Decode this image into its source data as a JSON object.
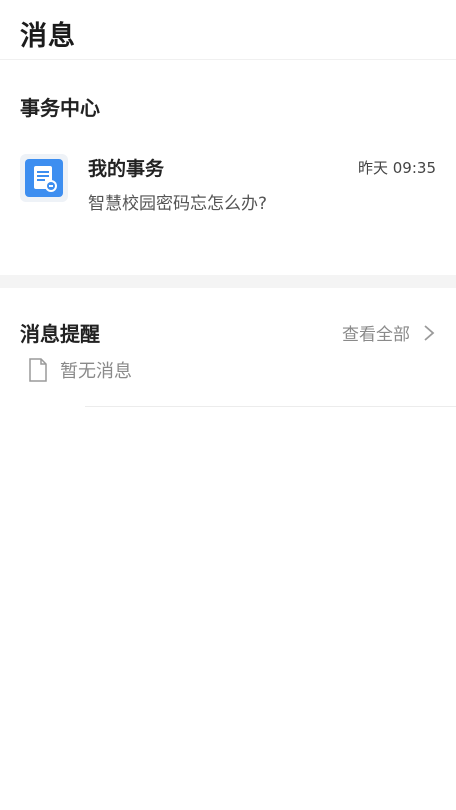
{
  "header": {
    "title": "消息"
  },
  "affairs": {
    "section_title": "事务中心",
    "item": {
      "icon": "document-icon",
      "name": "我的事务",
      "time": "昨天 09:35",
      "description": "智慧校园密码忘怎么办?"
    }
  },
  "notices": {
    "section_title": "消息提醒",
    "view_all": "查看全部",
    "empty_text": "暂无消息"
  },
  "colors": {
    "icon_blue": "#3d8ef0",
    "muted_text": "#8a8a8a"
  }
}
